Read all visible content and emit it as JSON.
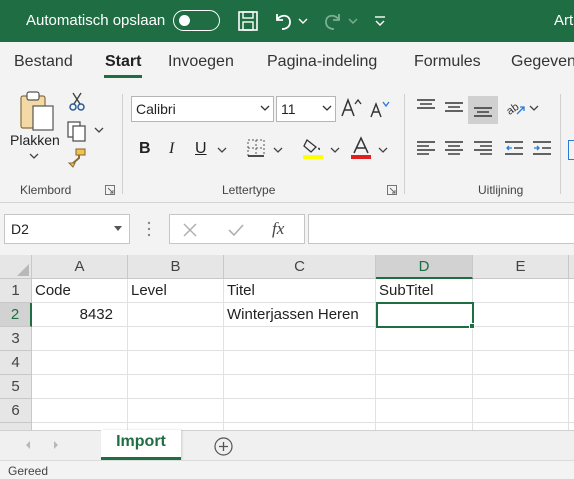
{
  "titlebar": {
    "autosave_label": "Automatisch opslaan",
    "title": "Art"
  },
  "ribbon_tabs": [
    "Bestand",
    "Start",
    "Invoegen",
    "Pagina-indeling",
    "Formules",
    "Gegevens"
  ],
  "active_tab": "Start",
  "clipboard": {
    "paste_label": "Plakken",
    "group_label": "Klembord"
  },
  "font": {
    "family": "Calibri",
    "size": "11",
    "bold_glyph": "B",
    "italic_glyph": "I",
    "underline_glyph": "U",
    "group_label": "Lettertype"
  },
  "alignment": {
    "group_label": "Uitlijning"
  },
  "formula_bar": {
    "name_box": "D2",
    "formula": ""
  },
  "grid": {
    "columns": [
      "A",
      "B",
      "C",
      "D",
      "E"
    ],
    "rows": [
      "1",
      "2",
      "3",
      "4",
      "5",
      "6"
    ],
    "selected_column": "D",
    "selected_row": "2",
    "cells": {
      "A1": "Code",
      "B1": "Level",
      "C1": "Titel",
      "D1": "SubTitel",
      "A2": "8432",
      "C2": "Winterjassen Heren"
    },
    "active_cell": "D2"
  },
  "sheets": {
    "tabs": [
      "Import"
    ],
    "active": "Import"
  },
  "status": {
    "text": "Gereed"
  },
  "colors": {
    "brand_green": "#1f6e43",
    "font_highlight": "#ffff00",
    "font_color": "#e02020"
  }
}
